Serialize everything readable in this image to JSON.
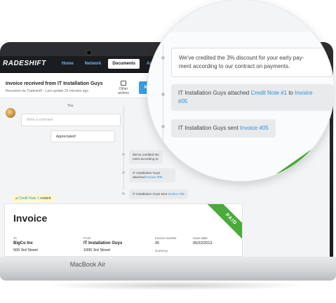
{
  "app": {
    "logo": "RADESHIFT",
    "nav": [
      "Home",
      "Network",
      "Documents",
      "Apps"
    ]
  },
  "doc": {
    "title": "Invoice received from IT Installation Guys",
    "subtitle": "Received via Tradeshift · Last update 25 minutes ago",
    "other_actions": "Other actions",
    "primary_btn": "M"
  },
  "conversation": {
    "you_label": "You",
    "comment_placeholder": "Write a comment",
    "appreciated": "Appreciated!",
    "system_1": "We've credited the 3% discount for your early payment according to our contract on payments.",
    "system_1_short_a": "We've credited the",
    "system_1_short_b": "ment according to",
    "system_2_prefix": "IT Installation Guys attached",
    "system_2_link": "Credit Note #1",
    "system_2_mid": "to",
    "system_2_link2": "Invoice #05",
    "system_3_prefix": "IT Installation Guys sent",
    "system_3_link": "Invoice #05"
  },
  "related": {
    "link": "Credit Note 1",
    "suffix": "related"
  },
  "invoice": {
    "title": "Invoice",
    "to_label": "To",
    "to_name": "BigCo Inc",
    "to_street": "500 3rd Street",
    "from_label": "From",
    "from_name": "IT Installation Guys",
    "from_street": "1000 3rd Street",
    "number_label": "Invoice number",
    "number_value": "05",
    "issue_label": "Issue date",
    "issue_value": "05/22/2013",
    "currency_label": "Currency",
    "status_badge": "PAID"
  },
  "magnified": {
    "line1": "We've credited the 3% discount for your early pay-",
    "line2": "ment according to our contract on payments.",
    "attached_prefix": "IT Installation Guys attached",
    "attached_link": "Credit Note #1",
    "attached_mid": "to",
    "attached_link2": "Invoice",
    "attached_link3": "#05",
    "sent_prefix": "IT Installation Guys sent",
    "sent_link": "Invoice #05"
  },
  "device": {
    "label": "MacBook Air"
  },
  "colors": {
    "accent": "#3a9ee8",
    "paid": "#4aaa3a",
    "link": "#2b8fd9"
  }
}
